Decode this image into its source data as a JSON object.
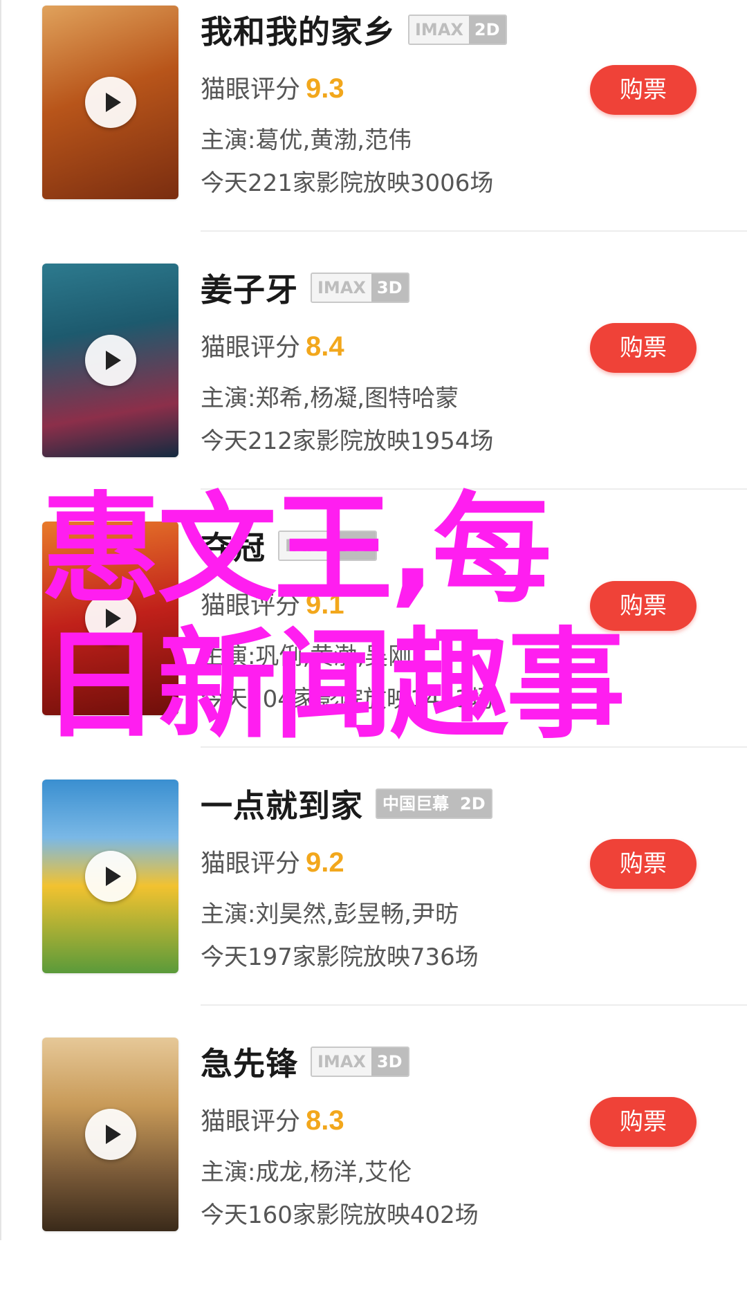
{
  "movies": [
    {
      "title": "我和我的家乡",
      "format_a": "IMAX",
      "format_b": "2D",
      "rating_label": "猫眼评分",
      "rating": "9.3",
      "cast": "主演:葛优,黄渤,范伟",
      "showing": "今天221家影院放映3006场",
      "buy_label": "购票",
      "poster_colors": [
        "#b8551a",
        "#e8a55a",
        "#7a2d10"
      ],
      "poster_caption": ""
    },
    {
      "title": "姜子牙",
      "format_a": "IMAX",
      "format_b": "3D",
      "rating_label": "猫眼评分",
      "rating": "8.4",
      "cast": "主演:郑希,杨凝,图特哈蒙",
      "showing": "今天212家影院放映1954场",
      "buy_label": "购票",
      "poster_colors": [
        "#1d5a6e",
        "#8c2f4a",
        "#132a40"
      ],
      "poster_caption": ""
    },
    {
      "title": "夺冠",
      "format_a": "IMAX",
      "format_b": "2D",
      "rating_label": "猫眼评分",
      "rating": "9.1",
      "cast": "主演:巩俐,黄渤,吴刚",
      "showing": "今天204家影院放映1453场",
      "buy_label": "购票",
      "poster_colors": [
        "#c0201a",
        "#e87a2a",
        "#6e0f0a"
      ],
      "poster_caption": ""
    },
    {
      "title": "一点就到家",
      "format_a": "中国巨幕",
      "format_b": "2D",
      "rating_label": "猫眼评分",
      "rating": "9.2",
      "cast": "主演:刘昊然,彭昱畅,尹昉",
      "showing": "今天197家影院放映736场",
      "buy_label": "购票",
      "poster_colors": [
        "#3a8fd0",
        "#f2c230",
        "#5a9a3a"
      ],
      "poster_caption": ""
    },
    {
      "title": "急先锋",
      "format_a": "IMAX",
      "format_b": "3D",
      "rating_label": "猫眼评分",
      "rating": "8.3",
      "cast": "主演:成龙,杨洋,艾伦",
      "showing": "今天160家影院放映402场",
      "buy_label": "购票",
      "poster_colors": [
        "#c89a58",
        "#7a5a38",
        "#3a2a1a"
      ],
      "poster_caption": ""
    }
  ],
  "watermark": {
    "line1": "惠文王,每",
    "line2": "日新闻趣事",
    "color": "#ff1ef0"
  },
  "colors": {
    "buy_button": "#ef4238",
    "rating": "#f2a71c",
    "title": "#1a1a1a"
  }
}
